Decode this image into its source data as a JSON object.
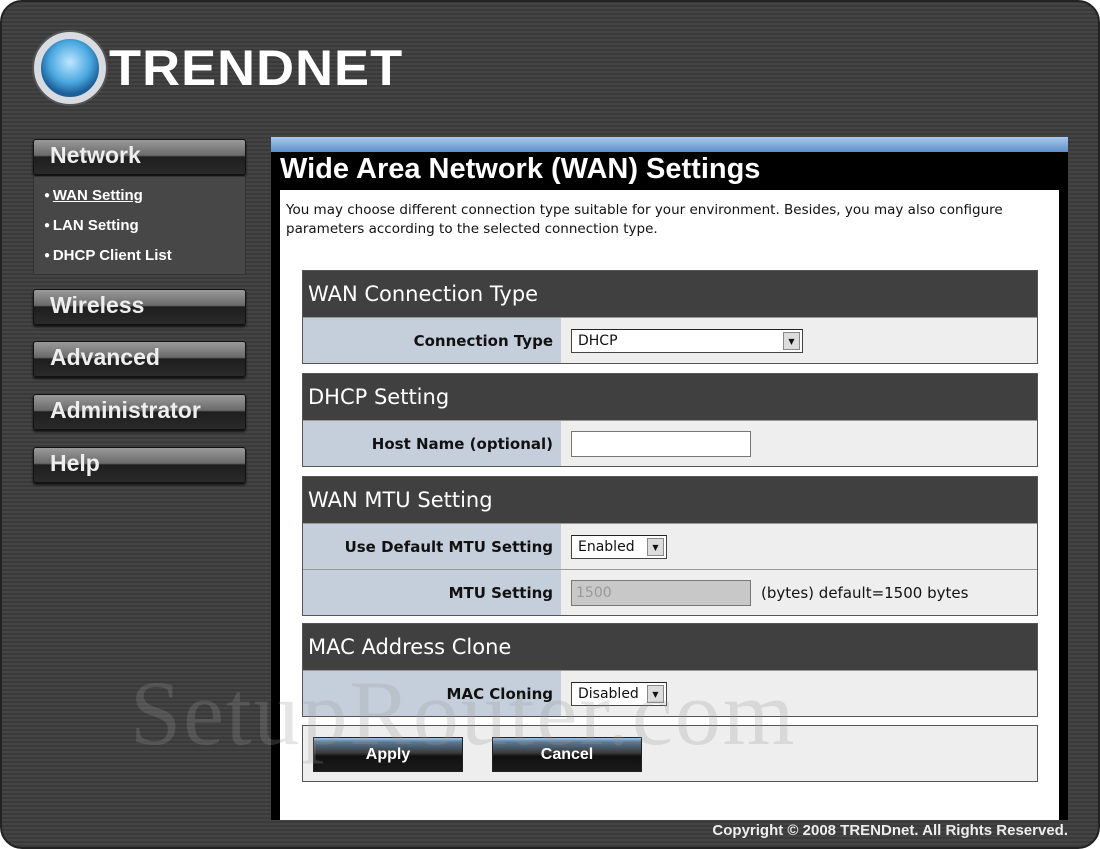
{
  "brand": {
    "logo_text": "TRENDNET"
  },
  "sidebar": {
    "network": "Network",
    "network_items": [
      {
        "label": "WAN Setting",
        "active": true
      },
      {
        "label": "LAN Setting"
      },
      {
        "label": "DHCP Client List"
      }
    ],
    "wireless": "Wireless",
    "advanced": "Advanced",
    "administrator": "Administrator",
    "help": "Help"
  },
  "page": {
    "title": "Wide Area Network (WAN) Settings",
    "description": "You may choose different connection type suitable for your environment. Besides, you may also configure parameters according to the selected connection type."
  },
  "sections": {
    "wan_type": {
      "title": "WAN Connection Type",
      "label": "Connection Type",
      "value": "DHCP"
    },
    "dhcp": {
      "title": "DHCP Setting",
      "label": "Host Name (optional)",
      "value": ""
    },
    "mtu": {
      "title": "WAN MTU Setting",
      "default_label": "Use Default MTU Setting",
      "default_value": "Enabled",
      "mtu_label": "MTU Setting",
      "mtu_value": "1500",
      "mtu_hint": "(bytes) default=1500 bytes"
    },
    "mac": {
      "title": "MAC Address Clone",
      "label": "MAC Cloning",
      "value": "Disabled"
    }
  },
  "buttons": {
    "apply": "Apply",
    "cancel": "Cancel"
  },
  "watermark": "SetupRouter.com",
  "footer": {
    "copyright": "Copyright © 2008 TRENDnet. All Rights Reserved."
  }
}
